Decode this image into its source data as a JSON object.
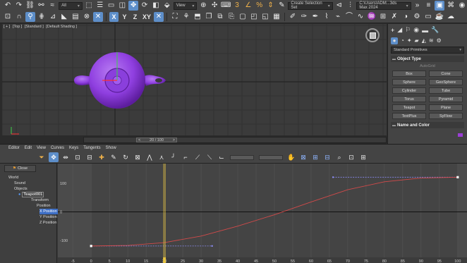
{
  "toolbar": {
    "selection_filter": "All",
    "ref_coord": "View",
    "selection_set": "Create Selection Set",
    "path": "C:\\Users\\ADM...3ds Max 2024",
    "axis_x": "X",
    "axis_y": "Y",
    "axis_z": "Z",
    "axis_xy": "XY"
  },
  "viewport": {
    "labels": [
      "[ + ]",
      "[Top ]",
      "[Standard ]",
      "[Default Shading ]"
    ]
  },
  "timeline": {
    "frame_display": "20 / 100",
    "prev": "<",
    "next": ">"
  },
  "command_panel": {
    "plus": "+",
    "category": "Standard Primitives",
    "object_type_title": "Object Type",
    "autogrid": "AutoGrid",
    "primitives": [
      "Box",
      "Cone",
      "Sphere",
      "GeoSphere",
      "Cylinder",
      "Tube",
      "Torus",
      "Pyramid",
      "Teapot",
      "Plane",
      "TextPlus",
      "SyFlow"
    ],
    "name_color_title": "Name and Color",
    "accent_color": "#9b3ed6"
  },
  "curve_editor": {
    "menu": [
      "Editor",
      "Edit",
      "View",
      "Curves",
      "Keys",
      "Tangents",
      "Show"
    ],
    "close_label": "Close",
    "tree": [
      {
        "label": "World"
      },
      {
        "label": "Sound"
      },
      {
        "label": "Objects"
      },
      {
        "label": "Teapot001"
      },
      {
        "label": "Transform"
      },
      {
        "label": "Position"
      },
      {
        "label": "X Position"
      },
      {
        "label": "Y Position"
      },
      {
        "label": "Z Position"
      }
    ]
  },
  "chart_data": {
    "type": "line",
    "x_ticks": [
      -5,
      0,
      5,
      10,
      15,
      20,
      25,
      30,
      35,
      40,
      45,
      50,
      55,
      60,
      65,
      70,
      75,
      80,
      85,
      90,
      95,
      100
    ],
    "y_ticks": [
      100,
      0,
      -100
    ],
    "xlim": [
      -6,
      101
    ],
    "ylim": [
      -160,
      160
    ],
    "current_frame": 20,
    "series": [
      {
        "x": [
          0,
          10,
          20,
          30,
          40,
          50,
          60,
          70,
          80,
          90,
          100
        ],
        "y": [
          -120,
          -118,
          -108,
          -85,
          -50,
          -10,
          35,
          78,
          106,
          119,
          122
        ]
      }
    ],
    "keys": [
      {
        "x": 0,
        "y": -120
      },
      {
        "x": 100,
        "y": 122
      }
    ]
  }
}
